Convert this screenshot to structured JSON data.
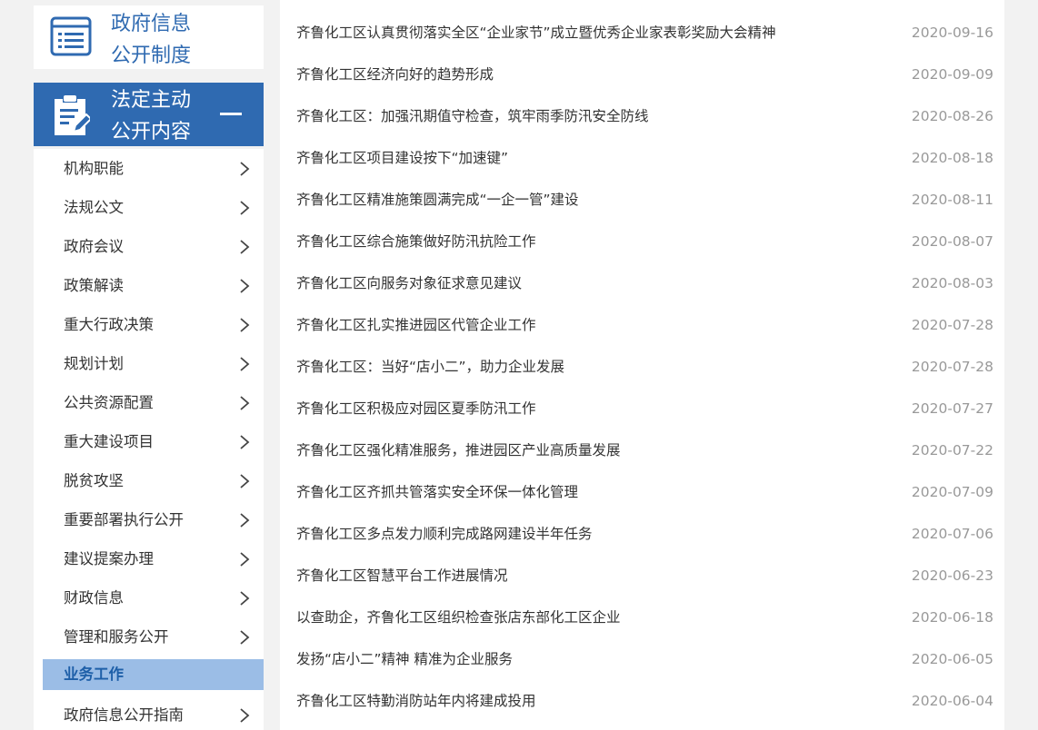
{
  "sidebar": {
    "top_block": {
      "title_line1": "政府信息",
      "title_line2": "公开制度",
      "icon": "document-list-icon"
    },
    "active_block": {
      "title_line1": "法定主动",
      "title_line2": "公开内容",
      "icon": "clipboard-edit-icon",
      "toggle": "collapse-minus-icon"
    },
    "items": [
      {
        "label": "机构职能",
        "chevron": true
      },
      {
        "label": "法规公文",
        "chevron": true
      },
      {
        "label": "政府会议",
        "chevron": true
      },
      {
        "label": "政策解读",
        "chevron": true
      },
      {
        "label": "重大行政决策",
        "chevron": true
      },
      {
        "label": "规划计划",
        "chevron": true
      },
      {
        "label": "公共资源配置",
        "chevron": true
      },
      {
        "label": "重大建设项目",
        "chevron": true
      },
      {
        "label": "脱贫攻坚",
        "chevron": true
      },
      {
        "label": "重要部署执行公开",
        "chevron": true
      },
      {
        "label": "建议提案办理",
        "chevron": true
      },
      {
        "label": "财政信息",
        "chevron": true
      },
      {
        "label": "管理和服务公开",
        "chevron": true
      },
      {
        "label": "业务工作",
        "chevron": false,
        "selected": true
      },
      {
        "label": "政府信息公开指南",
        "chevron": true
      }
    ]
  },
  "articles": [
    {
      "title": "齐鲁化工区认真贯彻落实全区“企业家节”成立暨优秀企业家表彰奖励大会精神",
      "date": "2020-09-16"
    },
    {
      "title": "齐鲁化工区经济向好的趋势形成",
      "date": "2020-09-09"
    },
    {
      "title": "齐鲁化工区：加强汛期值守检查，筑牢雨季防汛安全防线",
      "date": "2020-08-26"
    },
    {
      "title": "齐鲁化工区项目建设按下“加速键”",
      "date": "2020-08-18"
    },
    {
      "title": "齐鲁化工区精准施策圆满完成“一企一管”建设",
      "date": "2020-08-11"
    },
    {
      "title": "齐鲁化工区综合施策做好防汛抗险工作",
      "date": "2020-08-07"
    },
    {
      "title": "齐鲁化工区向服务对象征求意见建议",
      "date": "2020-08-03"
    },
    {
      "title": "齐鲁化工区扎实推进园区代管企业工作",
      "date": "2020-07-28"
    },
    {
      "title": "齐鲁化工区：当好“店小二”，助力企业发展",
      "date": "2020-07-28"
    },
    {
      "title": "齐鲁化工区积极应对园区夏季防汛工作",
      "date": "2020-07-27"
    },
    {
      "title": "齐鲁化工区强化精准服务，推进园区产业高质量发展",
      "date": "2020-07-22"
    },
    {
      "title": "齐鲁化工区齐抓共管落实安全环保一体化管理",
      "date": "2020-07-09"
    },
    {
      "title": "齐鲁化工区多点发力顺利完成路网建设半年任务",
      "date": "2020-07-06"
    },
    {
      "title": "齐鲁化工区智慧平台工作进展情况",
      "date": "2020-06-23"
    },
    {
      "title": "以查助企，齐鲁化工区组织检查张店东部化工区企业",
      "date": "2020-06-18"
    },
    {
      "title": "发扬“店小二”精神 精准为企业服务",
      "date": "2020-06-05"
    },
    {
      "title": "齐鲁化工区特勤消防站年内将建成投用",
      "date": "2020-06-04"
    }
  ],
  "colors": {
    "accent": "#2f6ab1",
    "selected_bg": "#9bbde6",
    "date": "#999999",
    "text": "#333333"
  }
}
